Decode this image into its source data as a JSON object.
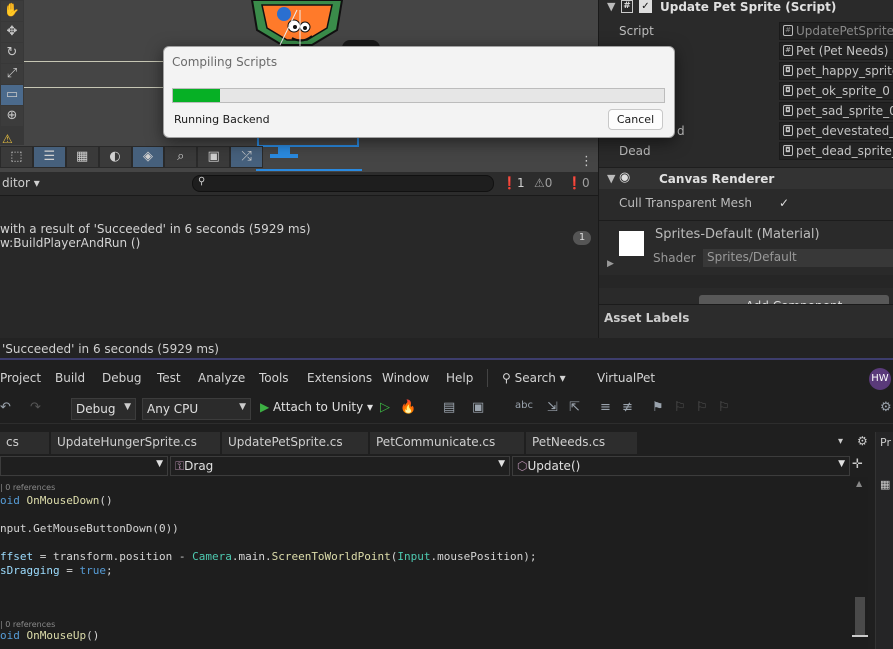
{
  "unity": {
    "scene_tools": [
      "hand-icon",
      "move-icon",
      "rotate-icon",
      "scale-icon",
      "rect-icon",
      "transform-icon"
    ],
    "console": {
      "filter_label": "ditor ▾",
      "count_errors": "1",
      "count_warnings": "0",
      "count_infos": "0",
      "line1": "with a result of 'Succeeded' in 6 seconds (5929 ms)",
      "line2": "w:BuildPlayerAndRun ()",
      "collapse_count": "1"
    },
    "status_line": "'Succeeded' in 6 seconds (5929 ms)"
  },
  "inspector": {
    "component_title": "Update Pet Sprite (Script)",
    "script_label": "Script",
    "script_value": "UpdatePetSprite",
    "pet_label_fragment": "e",
    "pet_value": "Pet (Pet Needs)",
    "happy_value": "pet_happy_sprite_",
    "ok_value": "pet_ok_sprite_0",
    "sad_value": "pet_sad_sprite_0",
    "devastated_label_fragment": "d",
    "devastated_value": "pet_devestated_s",
    "dead_label": "Dead",
    "dead_value": "pet_dead_sprite_",
    "canvas_renderer_title": "Canvas Renderer",
    "cull_label": "Cull Transparent Mesh",
    "material_name": "Sprites-Default (Material)",
    "shader_label": "Shader",
    "shader_value": "Sprites/Default",
    "add_component": "Add Component",
    "asset_labels": "Asset Labels"
  },
  "dialog": {
    "title": "Compiling Scripts",
    "progress": 0.095,
    "status": "Running Backend",
    "cancel_label": "Cancel",
    "progress_color": "#06b025"
  },
  "vs": {
    "menu": [
      "Project",
      "Build",
      "Debug",
      "Test",
      "Analyze",
      "Tools",
      "Extensions",
      "Window",
      "Help"
    ],
    "search_label": "Search",
    "solution_name": "VirtualPet",
    "user_initials": "HW",
    "config": "Debug",
    "platform": "Any CPU",
    "attach_label": "Attach to Unity",
    "tabs": [
      "cs",
      "UpdateHungerSprite.cs",
      "UpdatePetSprite.cs",
      "PetCommunicate.cs",
      "PetNeeds.cs"
    ],
    "nav_member": "Drag",
    "nav_method": "Update()",
    "right_strip_label": "Pr",
    "code": {
      "ref1": "| 0 references",
      "l1_kw": "oid",
      "l1_fn": "OnMouseDown",
      "l1_end": "()",
      "l2": "nput.GetMouseButtonDown(0))",
      "l3_a": "ffset",
      "l3_b": " = transform.position - ",
      "l3_c": "Camera",
      "l3_d": ".main.",
      "l3_e": "ScreenToWorldPoint",
      "l3_f": "(",
      "l3_g": "Input",
      "l3_h": ".mousePosition);",
      "l4_a": "sDragging",
      "l4_b": " = ",
      "l4_c": "true",
      "l4_d": ";",
      "ref2": "| 0 references",
      "l5_kw": "oid",
      "l5_fn": "OnMouseUp",
      "l5_end": "()"
    }
  }
}
